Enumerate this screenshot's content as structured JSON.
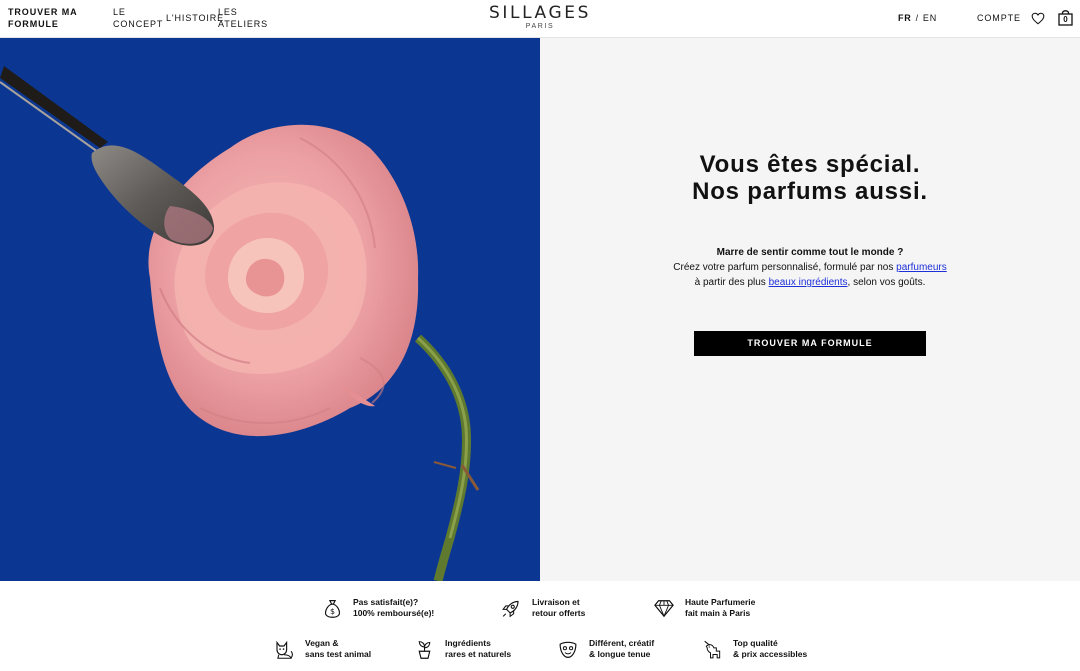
{
  "header": {
    "nav": {
      "trouver_ma_formule": "TROUVER MA FORMULE",
      "le_concept": "LE CONCEPT",
      "l_histoire": "L'HISTOIRE",
      "les_ateliers": "LES ATELIERS"
    },
    "logo": {
      "main": "SILLAGES",
      "sub": "PARIS"
    },
    "lang": {
      "fr": "FR",
      "separator": "/",
      "en": "EN"
    },
    "account": "COMPTE",
    "icons": {
      "wishlist": "heart-icon",
      "cart": "shopping-bag-icon"
    },
    "cart_count": "0"
  },
  "hero": {
    "image": "pink-rose-with-palette-knife-on-blue-background",
    "title_line1": "Vous êtes spécial.",
    "title_line2": "Nos parfums aussi.",
    "text_line1": "Marre de sentir comme tout le monde ?",
    "text_line2_before": "Créez votre parfum personnalisé, formulé par nos ",
    "text_line2_link": "parfumeurs",
    "text_line3_before": "à partir des plus ",
    "text_line3_link": "beaux ingrédients",
    "text_line3_after": ", selon vos goûts.",
    "cta": "TROUVER MA FORMULE"
  },
  "features": [
    {
      "icon": "money-bag-icon",
      "line1": "Pas satisfait(e)?",
      "line2": "100% remboursé(e)!"
    },
    {
      "icon": "rocket-icon",
      "line1": "Livraison et",
      "line2": "retour offerts"
    },
    {
      "icon": "diamond-icon",
      "line1": "Haute Parfumerie",
      "line2": "fait main à Paris"
    },
    {
      "icon": "cat-icon",
      "line1": "Vegan &",
      "line2": "sans test animal"
    },
    {
      "icon": "plant-icon",
      "line1": "Ingrédients",
      "line2": "rares et naturels"
    },
    {
      "icon": "mask-icon",
      "line1": "Différent, créatif",
      "line2": "& longue tenue"
    },
    {
      "icon": "unicorn-icon",
      "line1": "Top qualité",
      "line2": "& prix accessibles"
    }
  ],
  "colors": {
    "hero_blue": "#0b3792",
    "link_blue": "#1d2fd8",
    "rose_pink": "#eea2a4",
    "panel_gray": "#f5f5f5"
  }
}
